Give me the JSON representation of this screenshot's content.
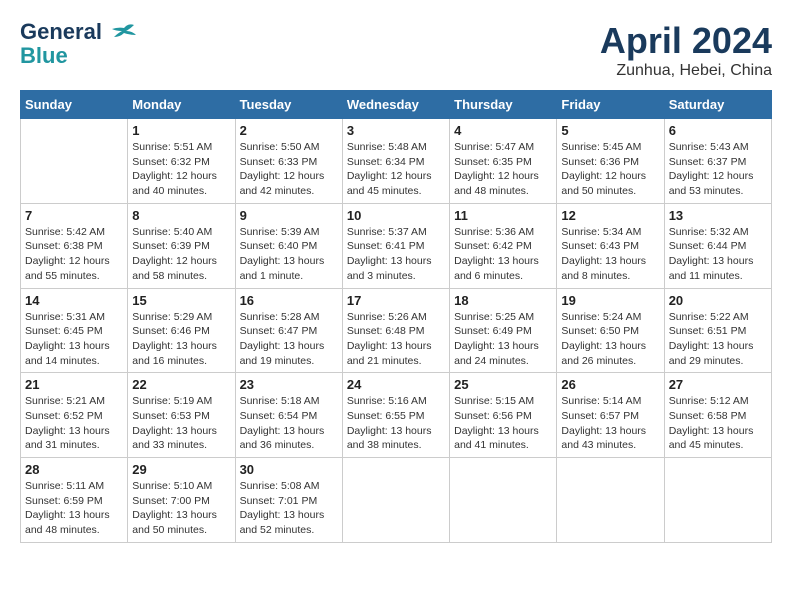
{
  "header": {
    "logo_line1": "General",
    "logo_line2": "Blue",
    "month": "April 2024",
    "location": "Zunhua, Hebei, China"
  },
  "weekdays": [
    "Sunday",
    "Monday",
    "Tuesday",
    "Wednesday",
    "Thursday",
    "Friday",
    "Saturday"
  ],
  "weeks": [
    [
      {
        "day": "",
        "info": ""
      },
      {
        "day": "1",
        "info": "Sunrise: 5:51 AM\nSunset: 6:32 PM\nDaylight: 12 hours\nand 40 minutes."
      },
      {
        "day": "2",
        "info": "Sunrise: 5:50 AM\nSunset: 6:33 PM\nDaylight: 12 hours\nand 42 minutes."
      },
      {
        "day": "3",
        "info": "Sunrise: 5:48 AM\nSunset: 6:34 PM\nDaylight: 12 hours\nand 45 minutes."
      },
      {
        "day": "4",
        "info": "Sunrise: 5:47 AM\nSunset: 6:35 PM\nDaylight: 12 hours\nand 48 minutes."
      },
      {
        "day": "5",
        "info": "Sunrise: 5:45 AM\nSunset: 6:36 PM\nDaylight: 12 hours\nand 50 minutes."
      },
      {
        "day": "6",
        "info": "Sunrise: 5:43 AM\nSunset: 6:37 PM\nDaylight: 12 hours\nand 53 minutes."
      }
    ],
    [
      {
        "day": "7",
        "info": "Sunrise: 5:42 AM\nSunset: 6:38 PM\nDaylight: 12 hours\nand 55 minutes."
      },
      {
        "day": "8",
        "info": "Sunrise: 5:40 AM\nSunset: 6:39 PM\nDaylight: 12 hours\nand 58 minutes."
      },
      {
        "day": "9",
        "info": "Sunrise: 5:39 AM\nSunset: 6:40 PM\nDaylight: 13 hours\nand 1 minute."
      },
      {
        "day": "10",
        "info": "Sunrise: 5:37 AM\nSunset: 6:41 PM\nDaylight: 13 hours\nand 3 minutes."
      },
      {
        "day": "11",
        "info": "Sunrise: 5:36 AM\nSunset: 6:42 PM\nDaylight: 13 hours\nand 6 minutes."
      },
      {
        "day": "12",
        "info": "Sunrise: 5:34 AM\nSunset: 6:43 PM\nDaylight: 13 hours\nand 8 minutes."
      },
      {
        "day": "13",
        "info": "Sunrise: 5:32 AM\nSunset: 6:44 PM\nDaylight: 13 hours\nand 11 minutes."
      }
    ],
    [
      {
        "day": "14",
        "info": "Sunrise: 5:31 AM\nSunset: 6:45 PM\nDaylight: 13 hours\nand 14 minutes."
      },
      {
        "day": "15",
        "info": "Sunrise: 5:29 AM\nSunset: 6:46 PM\nDaylight: 13 hours\nand 16 minutes."
      },
      {
        "day": "16",
        "info": "Sunrise: 5:28 AM\nSunset: 6:47 PM\nDaylight: 13 hours\nand 19 minutes."
      },
      {
        "day": "17",
        "info": "Sunrise: 5:26 AM\nSunset: 6:48 PM\nDaylight: 13 hours\nand 21 minutes."
      },
      {
        "day": "18",
        "info": "Sunrise: 5:25 AM\nSunset: 6:49 PM\nDaylight: 13 hours\nand 24 minutes."
      },
      {
        "day": "19",
        "info": "Sunrise: 5:24 AM\nSunset: 6:50 PM\nDaylight: 13 hours\nand 26 minutes."
      },
      {
        "day": "20",
        "info": "Sunrise: 5:22 AM\nSunset: 6:51 PM\nDaylight: 13 hours\nand 29 minutes."
      }
    ],
    [
      {
        "day": "21",
        "info": "Sunrise: 5:21 AM\nSunset: 6:52 PM\nDaylight: 13 hours\nand 31 minutes."
      },
      {
        "day": "22",
        "info": "Sunrise: 5:19 AM\nSunset: 6:53 PM\nDaylight: 13 hours\nand 33 minutes."
      },
      {
        "day": "23",
        "info": "Sunrise: 5:18 AM\nSunset: 6:54 PM\nDaylight: 13 hours\nand 36 minutes."
      },
      {
        "day": "24",
        "info": "Sunrise: 5:16 AM\nSunset: 6:55 PM\nDaylight: 13 hours\nand 38 minutes."
      },
      {
        "day": "25",
        "info": "Sunrise: 5:15 AM\nSunset: 6:56 PM\nDaylight: 13 hours\nand 41 minutes."
      },
      {
        "day": "26",
        "info": "Sunrise: 5:14 AM\nSunset: 6:57 PM\nDaylight: 13 hours\nand 43 minutes."
      },
      {
        "day": "27",
        "info": "Sunrise: 5:12 AM\nSunset: 6:58 PM\nDaylight: 13 hours\nand 45 minutes."
      }
    ],
    [
      {
        "day": "28",
        "info": "Sunrise: 5:11 AM\nSunset: 6:59 PM\nDaylight: 13 hours\nand 48 minutes."
      },
      {
        "day": "29",
        "info": "Sunrise: 5:10 AM\nSunset: 7:00 PM\nDaylight: 13 hours\nand 50 minutes."
      },
      {
        "day": "30",
        "info": "Sunrise: 5:08 AM\nSunset: 7:01 PM\nDaylight: 13 hours\nand 52 minutes."
      },
      {
        "day": "",
        "info": ""
      },
      {
        "day": "",
        "info": ""
      },
      {
        "day": "",
        "info": ""
      },
      {
        "day": "",
        "info": ""
      }
    ]
  ]
}
